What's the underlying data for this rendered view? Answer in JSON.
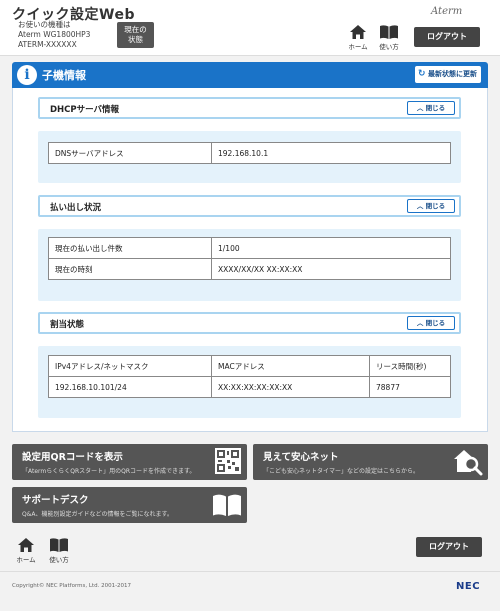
{
  "header": {
    "app_title": "クイック設定Web",
    "model_prefix": "お使いの機種は",
    "model_name": "Aterm WG1800HP3",
    "device_id": "ATERM-XXXXXX",
    "status_button_line1": "現在の",
    "status_button_line2": "状態",
    "brand": "Aterm",
    "home_label": "ホーム",
    "howto_label": "使い方",
    "logout_label": "ログアウト"
  },
  "panel": {
    "title": "子機情報",
    "refresh_label": "最新状態に更新"
  },
  "sections": {
    "dhcp": {
      "title": "DHCPサーバ情報",
      "close_label": "閉じる",
      "dns_label": "DNSサーバアドレス",
      "dns_value": "192.168.10.1"
    },
    "lease": {
      "title": "払い出し状況",
      "close_label": "閉じる",
      "count_label": "現在の払い出し件数",
      "count_value": "1/100",
      "time_label": "現在の時刻",
      "time_value": "XXXX/XX/XX XX:XX:XX"
    },
    "assign": {
      "title": "割当状態",
      "close_label": "閉じる",
      "columns": [
        "IPv4アドレス/ネットマスク",
        "MACアドレス",
        "リース時間(秒)"
      ],
      "rows": [
        [
          "192.168.10.101/24",
          "XX:XX:XX:XX:XX:XX",
          "78877"
        ]
      ]
    }
  },
  "tiles": {
    "qr": {
      "title": "設定用QRコードを表示",
      "desc": "「AtermらくらくQRスタート」用のQRコードを作成できます。"
    },
    "safety": {
      "title": "見えて安心ネット",
      "desc": "「こども安心ネットタイマー」などの設定はこちらから。"
    },
    "support": {
      "title": "サポートデスク",
      "desc": "Q&A、機能別設定ガイドなどの情報をご覧になれます。"
    }
  },
  "footer": {
    "home_label": "ホーム",
    "howto_label": "使い方",
    "logout_label": "ログアウト",
    "copyright": "Copyright© NEC Platforms, Ltd. 2001-2017",
    "nec": "NEC"
  },
  "colors": {
    "accent_blue": "#1a73c8",
    "section_bg": "#e4f2fb",
    "tile_gray": "#555555"
  }
}
